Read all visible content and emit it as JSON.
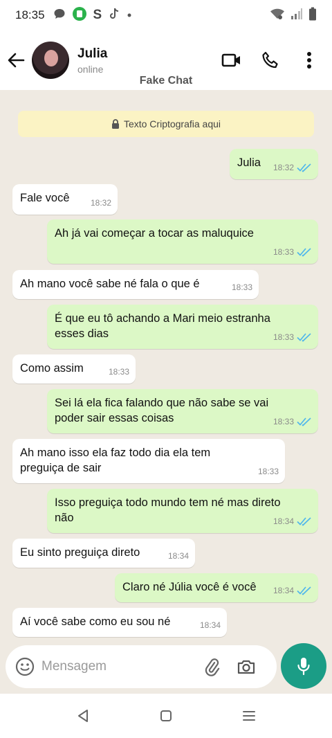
{
  "status_bar": {
    "time": "18:35",
    "icons": [
      "message-icon",
      "app-icon",
      "s-icon",
      "tiktok-icon",
      "dot-icon",
      "wifi-icon",
      "signal-icon",
      "battery-icon"
    ]
  },
  "header": {
    "contact_name": "Julia",
    "contact_status": "online",
    "subtitle": "Fake Chat"
  },
  "notice": {
    "text": "Texto Criptografia aqui"
  },
  "messages": [
    {
      "dir": "out",
      "text": "Julia",
      "time": "18:32",
      "read": true
    },
    {
      "dir": "in",
      "text": "Fale você",
      "time": "18:32"
    },
    {
      "dir": "out",
      "text": "Ah já vai começar a tocar as maluquice",
      "time": "18:33",
      "read": true
    },
    {
      "dir": "in",
      "text": "Ah mano você sabe né fala o que é",
      "time": "18:33"
    },
    {
      "dir": "out",
      "line1": "É que eu tô achando a Mari meio estranha",
      "line2": "esses dias",
      "time": "18:33",
      "read": true
    },
    {
      "dir": "in",
      "text": "Como assim",
      "time": "18:33"
    },
    {
      "dir": "out",
      "line1": "Sei lá ela fica falando que não sabe se vai",
      "line2": "poder sair essas coisas",
      "time": "18:33",
      "read": true
    },
    {
      "dir": "in",
      "line1": "Ah mano isso ela faz todo dia ela tem",
      "line2": "preguiça de sair",
      "time": "18:33"
    },
    {
      "dir": "out",
      "line1": "Isso preguiça todo mundo tem né mas direto",
      "line2": "não",
      "time": "18:34",
      "read": true
    },
    {
      "dir": "in",
      "text": "Eu sinto preguiça direto",
      "time": "18:34"
    },
    {
      "dir": "out",
      "text": "Claro né Júlia você é você",
      "time": "18:34",
      "read": true
    },
    {
      "dir": "in",
      "text": "Aí você sabe como eu sou né",
      "time": "18:34"
    }
  ],
  "composer": {
    "placeholder": "Mensagem"
  },
  "colors": {
    "outgoing_bubble": "#dcf8c6",
    "incoming_bubble": "#ffffff",
    "accent": "#1b9d86",
    "read_ticks": "#4fb6ec",
    "notice_bg": "#fbf3c4"
  }
}
